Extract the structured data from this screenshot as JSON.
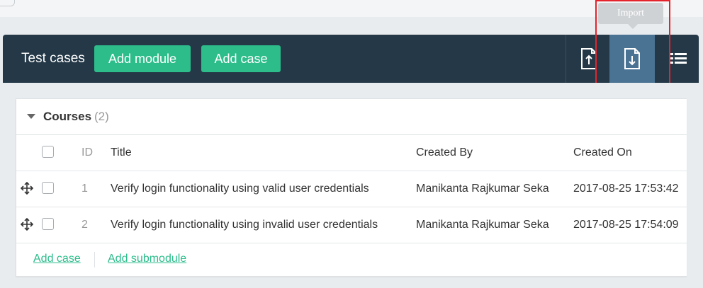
{
  "toolbar": {
    "title": "Test cases",
    "add_module_label": "Add module",
    "add_case_label": "Add case",
    "tooltip": "Import"
  },
  "module": {
    "name": "Courses",
    "count": "(2)"
  },
  "table": {
    "columns": [
      "ID",
      "Title",
      "Created By",
      "Created On"
    ],
    "rows": [
      {
        "id": "1",
        "title": "Verify login functionality using valid user credentials",
        "created_by": "Manikanta Rajkumar Seka",
        "created_on": "2017-08-25 17:53:42"
      },
      {
        "id": "2",
        "title": "Verify login functionality using invalid user credentials",
        "created_by": "Manikanta Rajkumar Seka",
        "created_on": "2017-08-25 17:54:09"
      }
    ]
  },
  "footer": {
    "add_case": "Add case",
    "add_submodule": "Add submodule"
  },
  "icons": {
    "export": "export-icon",
    "import": "import-icon",
    "list": "list-view-icon",
    "drag": "drag-handle-icon",
    "caret": "caret-down-icon"
  },
  "colors": {
    "toolbar_bg": "#243847",
    "accent_green": "#2dbd8b",
    "import_active": "#4a7393",
    "highlight": "#e4232c"
  }
}
